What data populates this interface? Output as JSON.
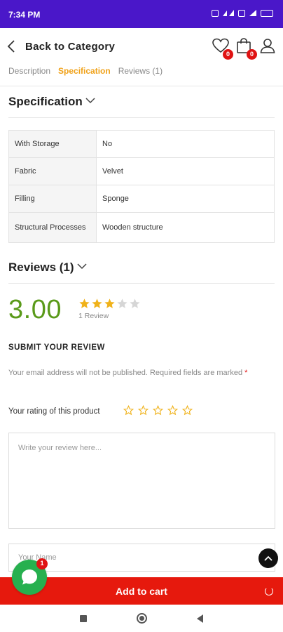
{
  "status_bar": {
    "time": "7:34 PM"
  },
  "header": {
    "back_label": "Back to Category",
    "wishlist_count": "0",
    "cart_count": "0"
  },
  "tabs": [
    {
      "label": "Description",
      "active": false
    },
    {
      "label": "Specification",
      "active": true
    },
    {
      "label": "Reviews (1)",
      "active": false
    }
  ],
  "specification": {
    "heading": "Specification",
    "rows": [
      {
        "key": "With Storage",
        "value": "No"
      },
      {
        "key": "Fabric",
        "value": "Velvet"
      },
      {
        "key": "Filling",
        "value": "Sponge"
      },
      {
        "key": "Structural Processes",
        "value": "Wooden structure"
      }
    ]
  },
  "reviews": {
    "heading": "Reviews (1)",
    "average": "3.00",
    "rating": 3,
    "rating_max": 5,
    "count_label": "1 Review",
    "submit_title": "SUBMIT YOUR REVIEW",
    "notice": "Your email address will not be published. Required fields are marked",
    "required_mark": "*",
    "rating_label": "Your rating of this product",
    "review_placeholder": "Write your review here...",
    "name_placeholder": "Your Name"
  },
  "cart": {
    "label": "Add to cart"
  },
  "chat": {
    "badge": "1"
  },
  "colors": {
    "status_bar": "#4a17c9",
    "accent_tab": "#f0a21a",
    "rating_green": "#5a9a1a",
    "star_gold": "#f0b21a",
    "cart_red": "#e6190d",
    "whatsapp_green": "#27b04f",
    "badge_red": "#e01313"
  }
}
